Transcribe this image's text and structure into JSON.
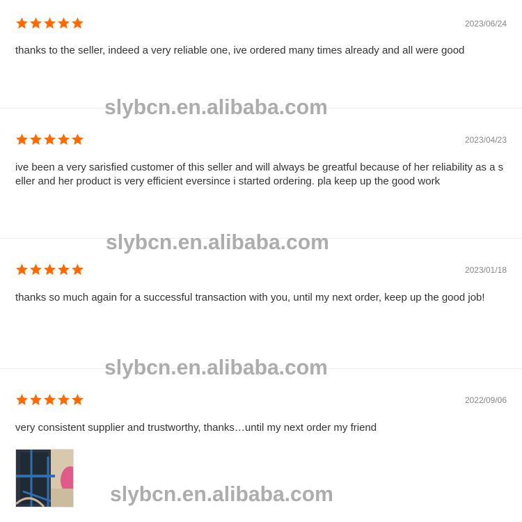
{
  "reviews": [
    {
      "rating": 5,
      "date": "2023/06/24",
      "text": "thanks to the seller, indeed a very reliable one, ive ordered many times already and all were good"
    },
    {
      "rating": 5,
      "date": "2023/04/23",
      "text": "ive been a very sarisfied customer of this seller and will always be greatful because of her reliability as a seller and her product is very efficient eversince i started ordering. pla keep up the good work"
    },
    {
      "rating": 5,
      "date": "2023/01/18",
      "text": "thanks so much again for a successful transaction with you, until my next order, keep up the good job!"
    },
    {
      "rating": 5,
      "date": "2022/09/06",
      "text": "very consistent supplier and trustworthy, thanks…until my next order my friend"
    }
  ],
  "watermark": "slybcn.en.alibaba.com",
  "colors": {
    "star": "#ff6a00",
    "divider": "#eeeeee",
    "date": "#888888",
    "text": "#333333"
  },
  "icons": {
    "star": "star-icon"
  }
}
